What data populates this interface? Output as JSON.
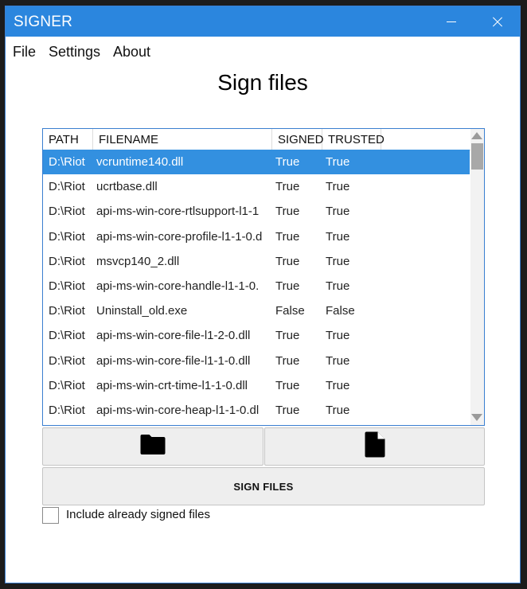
{
  "window": {
    "title": "SIGNER"
  },
  "menu": {
    "items": [
      "File",
      "Settings",
      "About"
    ]
  },
  "page": {
    "heading": "Sign files"
  },
  "table": {
    "columns": [
      "PATH",
      "FILENAME",
      "SIGNED",
      "TRUSTED"
    ],
    "rows": [
      {
        "path": "D:\\Riot",
        "filename": "vcruntime140.dll",
        "signed": "True",
        "trusted": "True"
      },
      {
        "path": "D:\\Riot",
        "filename": "ucrtbase.dll",
        "signed": "True",
        "trusted": "True"
      },
      {
        "path": "D:\\Riot",
        "filename": "api-ms-win-core-rtlsupport-l1-1",
        "signed": "True",
        "trusted": "True"
      },
      {
        "path": "D:\\Riot",
        "filename": "api-ms-win-core-profile-l1-1-0.d",
        "signed": "True",
        "trusted": "True"
      },
      {
        "path": "D:\\Riot",
        "filename": "msvcp140_2.dll",
        "signed": "True",
        "trusted": "True"
      },
      {
        "path": "D:\\Riot",
        "filename": "api-ms-win-core-handle-l1-1-0.",
        "signed": "True",
        "trusted": "True"
      },
      {
        "path": "D:\\Riot",
        "filename": "Uninstall_old.exe",
        "signed": "False",
        "trusted": "False"
      },
      {
        "path": "D:\\Riot",
        "filename": "api-ms-win-core-file-l1-2-0.dll",
        "signed": "True",
        "trusted": "True"
      },
      {
        "path": "D:\\Riot",
        "filename": "api-ms-win-core-file-l1-1-0.dll",
        "signed": "True",
        "trusted": "True"
      },
      {
        "path": "D:\\Riot",
        "filename": "api-ms-win-crt-time-l1-1-0.dll",
        "signed": "True",
        "trusted": "True"
      },
      {
        "path": "D:\\Riot",
        "filename": "api-ms-win-core-heap-l1-1-0.dl",
        "signed": "True",
        "trusted": "True"
      }
    ],
    "selected_row": 0
  },
  "buttons": {
    "folder_icon": "folder-icon",
    "file_icon": "file-icon",
    "sign_label": "SIGN FILES"
  },
  "options": {
    "include_signed_label": "Include already signed files",
    "include_signed_checked": false
  },
  "colors": {
    "accent": "#2b86de",
    "selection": "#3390e0"
  }
}
